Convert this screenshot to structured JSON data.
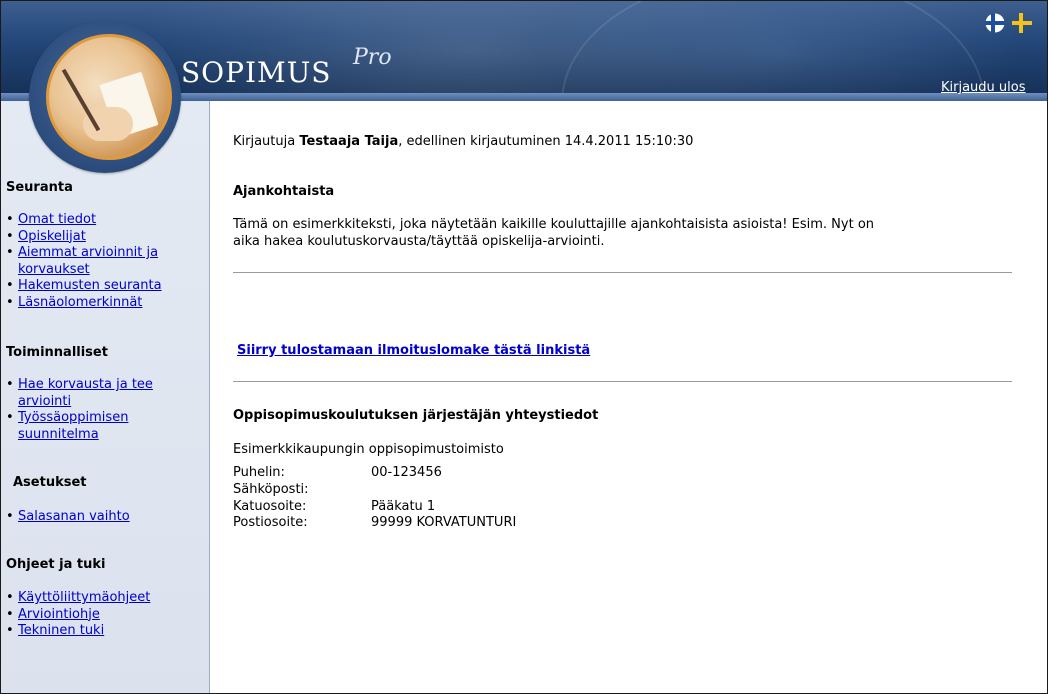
{
  "header": {
    "brand": "SOPIMUS",
    "brand_suffix": "Pro",
    "logout_label": "Kirjaudu ulos",
    "flags": [
      "finland-flag-icon",
      "sweden-flag-icon"
    ]
  },
  "sidebar": {
    "sections": [
      {
        "title": "Seuranta",
        "items": [
          "Omat tiedot",
          "Opiskelijat",
          "Aiemmat arvioinnit ja korvaukset",
          "Hakemusten seuranta",
          "Läsnäolomerkinnät"
        ]
      },
      {
        "title": "Toiminnalliset",
        "items": [
          "Hae korvausta ja tee arviointi",
          "Työssäoppimisen suunnitelma"
        ]
      },
      {
        "title": "Asetukset",
        "items": [
          "Salasanan vaihto"
        ]
      },
      {
        "title": "Ohjeet ja tuki",
        "items": [
          "Käyttöliittymäohjeet",
          "Arviointiohje",
          "Tekninen tuki"
        ]
      }
    ]
  },
  "main": {
    "login_prefix": "Kirjautuja ",
    "user_name": "Testaaja Taija",
    "login_suffix": ", edellinen kirjautuminen 14.4.2011 15:10:30",
    "news_title": "Ajankohtaista",
    "news_line1": "Tämä on esimerkkiteksti, joka näytetään kaikille kouluttajille ajankohtaisista asioista! Esim. Nyt on",
    "news_line2": "aika hakea koulutuskorvausta/täyttää opiskelija-arviointi.",
    "form_link": "Siirry tulostamaan ilmoituslomake tästä linkistä",
    "contact_title": "Oppisopimuskoulutuksen järjestäjän yhteystiedot",
    "org_name": "Esimerkkikaupungin oppisopimustoimisto",
    "contact": [
      {
        "label": "Puhelin:",
        "value": "00-123456"
      },
      {
        "label": "Sähköposti:",
        "value": ""
      },
      {
        "label": "Katuosoite:",
        "value": "Pääkatu 1"
      },
      {
        "label": "Postiosoite:",
        "value": "99999 KORVATUNTURI"
      }
    ]
  },
  "colors": {
    "header": "#1b3a66",
    "sidebar": "#dde4ef",
    "link": "#0000cc"
  }
}
